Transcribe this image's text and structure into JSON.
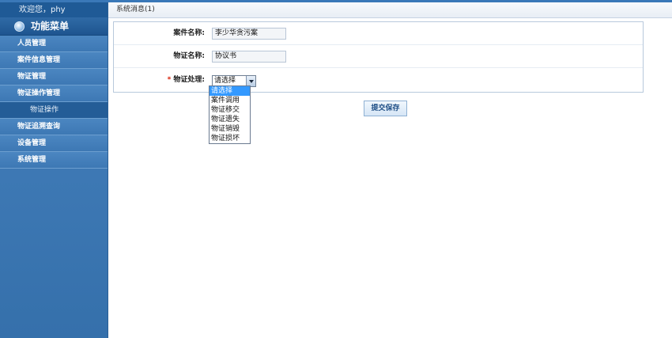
{
  "sidebar": {
    "welcome": "欢迎您，phy",
    "menu_title": "功能菜单",
    "items": [
      {
        "label": "人员管理"
      },
      {
        "label": "案件信息管理"
      },
      {
        "label": "物证管理"
      },
      {
        "label": "物证操作管理"
      },
      {
        "label": "物证操作"
      },
      {
        "label": "物证追溯查询"
      },
      {
        "label": "设备管理"
      },
      {
        "label": "系统管理"
      }
    ]
  },
  "main": {
    "status_text": "系统消息(1)",
    "form": {
      "case_name_label": "案件名称:",
      "case_name_value": "李少华贪污案",
      "evidence_name_label": "物证名称:",
      "evidence_name_value": "协议书",
      "required_mark": "*",
      "action_label": "物证处理:",
      "action_selected": "请选择",
      "action_options": [
        "请选择",
        "案件调用",
        "物证移交",
        "物证遗失",
        "物证销毁",
        "物证损坏"
      ]
    },
    "submit_label": "提交保存"
  },
  "colors": {
    "sidebar_bg": "#3f7ab6",
    "header_bg": "#1f5a96",
    "highlight": "#3399ff",
    "required": "#d81e06"
  }
}
